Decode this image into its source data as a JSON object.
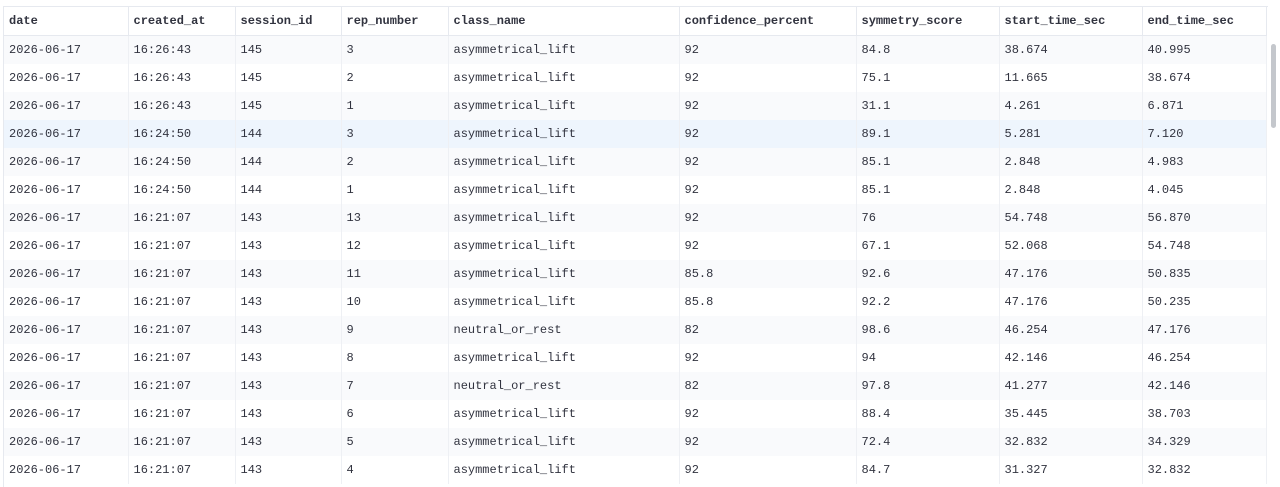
{
  "columns": [
    "date",
    "created_at",
    "session_id",
    "rep_number",
    "class_name",
    "confidence_percent",
    "symmetry_score",
    "start_time_sec",
    "end_time_sec"
  ],
  "rows": [
    [
      "2026-06-17",
      "16:26:43",
      "145",
      "3",
      "asymmetrical_lift",
      "92",
      "84.8",
      "38.674",
      "40.995"
    ],
    [
      "2026-06-17",
      "16:26:43",
      "145",
      "2",
      "asymmetrical_lift",
      "92",
      "75.1",
      "11.665",
      "38.674"
    ],
    [
      "2026-06-17",
      "16:26:43",
      "145",
      "1",
      "asymmetrical_lift",
      "92",
      "31.1",
      "4.261",
      "6.871"
    ],
    [
      "2026-06-17",
      "16:24:50",
      "144",
      "3",
      "asymmetrical_lift",
      "92",
      "89.1",
      "5.281",
      "7.120"
    ],
    [
      "2026-06-17",
      "16:24:50",
      "144",
      "2",
      "asymmetrical_lift",
      "92",
      "85.1",
      "2.848",
      "4.983"
    ],
    [
      "2026-06-17",
      "16:24:50",
      "144",
      "1",
      "asymmetrical_lift",
      "92",
      "85.1",
      "2.848",
      "4.045"
    ],
    [
      "2026-06-17",
      "16:21:07",
      "143",
      "13",
      "asymmetrical_lift",
      "92",
      "76",
      "54.748",
      "56.870"
    ],
    [
      "2026-06-17",
      "16:21:07",
      "143",
      "12",
      "asymmetrical_lift",
      "92",
      "67.1",
      "52.068",
      "54.748"
    ],
    [
      "2026-06-17",
      "16:21:07",
      "143",
      "11",
      "asymmetrical_lift",
      "85.8",
      "92.6",
      "47.176",
      "50.835"
    ],
    [
      "2026-06-17",
      "16:21:07",
      "143",
      "10",
      "asymmetrical_lift",
      "85.8",
      "92.2",
      "47.176",
      "50.235"
    ],
    [
      "2026-06-17",
      "16:21:07",
      "143",
      "9",
      "neutral_or_rest",
      "82",
      "98.6",
      "46.254",
      "47.176"
    ],
    [
      "2026-06-17",
      "16:21:07",
      "143",
      "8",
      "asymmetrical_lift",
      "92",
      "94",
      "42.146",
      "46.254"
    ],
    [
      "2026-06-17",
      "16:21:07",
      "143",
      "7",
      "neutral_or_rest",
      "82",
      "97.8",
      "41.277",
      "42.146"
    ],
    [
      "2026-06-17",
      "16:21:07",
      "143",
      "6",
      "asymmetrical_lift",
      "92",
      "88.4",
      "35.445",
      "38.703"
    ],
    [
      "2026-06-17",
      "16:21:07",
      "143",
      "5",
      "asymmetrical_lift",
      "92",
      "72.4",
      "32.832",
      "34.329"
    ],
    [
      "2026-06-17",
      "16:21:07",
      "143",
      "4",
      "asymmetrical_lift",
      "92",
      "84.7",
      "31.327",
      "32.832"
    ]
  ],
  "highlighted_row_index": 3,
  "colors": {
    "text": "#31333f",
    "grid": "#e6e9ef",
    "row_alt": "#f9fafc",
    "row_highlight": "#eef5fd",
    "scroll_thumb": "#c4c7cc"
  }
}
